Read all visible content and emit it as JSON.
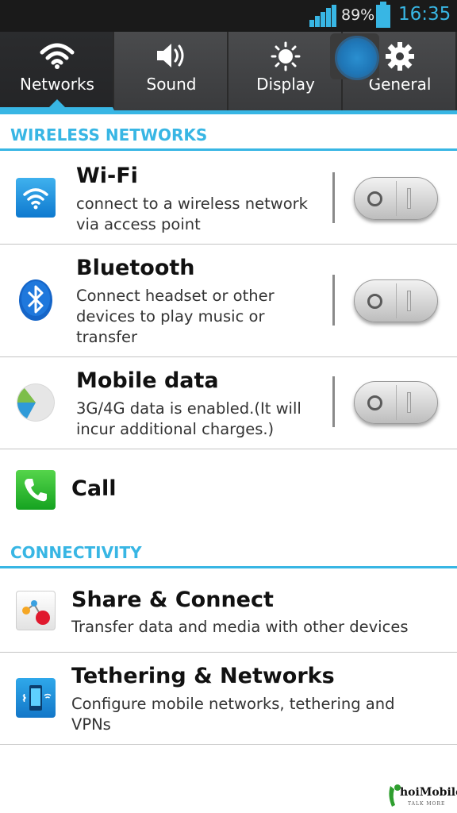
{
  "status_bar": {
    "battery_percent": "89%",
    "battery_level": 0.89,
    "time": "16:35",
    "accent_color": "#38b6e4"
  },
  "tabs": [
    {
      "label": "Networks",
      "icon": "wifi-icon",
      "active": true
    },
    {
      "label": "Sound",
      "icon": "speaker-icon",
      "active": false
    },
    {
      "label": "Display",
      "icon": "brightness-icon",
      "active": false
    },
    {
      "label": "General",
      "icon": "gear-icon",
      "active": false
    }
  ],
  "sections": {
    "wireless": {
      "header": "WIRELESS NETWORKS",
      "items": [
        {
          "title": "Wi-Fi",
          "desc1": "connect to a wireless network",
          "desc2": "via access point",
          "desc3": "",
          "icon": "wifi-icon",
          "toggle": "off"
        },
        {
          "title": "Bluetooth",
          "desc1": "Connect headset or other",
          "desc2": "devices to play music or",
          "desc3": "transfer",
          "icon": "bluetooth-icon",
          "toggle": "off"
        },
        {
          "title": "Mobile data",
          "desc1": "3G/4G data is enabled.(It will",
          "desc2": "incur additional charges.)",
          "desc3": "",
          "icon": "mobile-data-pie-icon",
          "toggle": "off"
        },
        {
          "title": "Call",
          "icon": "phone-icon"
        }
      ]
    },
    "connectivity": {
      "header": "CONNECTIVITY",
      "items": [
        {
          "title": "Share & Connect",
          "desc1": "Transfer data and media with other devices",
          "icon": "share-connect-icon"
        },
        {
          "title": "Tethering & Networks",
          "desc1": "Configure mobile networks, tethering and",
          "desc2": "VPNs",
          "icon": "tethering-icon"
        }
      ]
    }
  },
  "watermark": {
    "brand": "hoiMobile",
    "tagline": "TALK MORE"
  }
}
